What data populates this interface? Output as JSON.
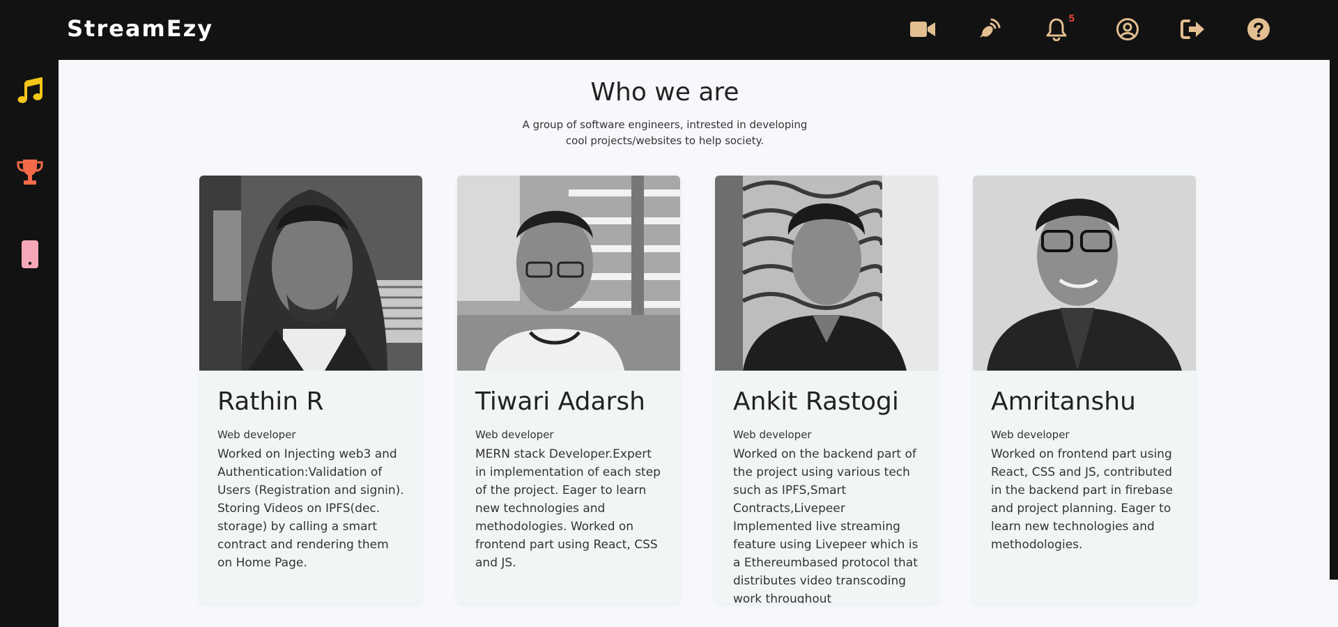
{
  "app": {
    "brand": "StreamEzy"
  },
  "topbar": {
    "icons": [
      {
        "name": "video-camera-icon"
      },
      {
        "name": "broadcast-icon"
      },
      {
        "name": "bell-icon",
        "badge": "5"
      },
      {
        "name": "user-circle-icon"
      },
      {
        "name": "logout-icon"
      },
      {
        "name": "help-icon"
      }
    ],
    "icon_color": "#e3be90",
    "badge_color": "#f0473c"
  },
  "sidebar": {
    "icons": [
      {
        "name": "music-note-icon",
        "color": "#f5c518"
      },
      {
        "name": "trophy-icon",
        "color": "#f36a4a"
      },
      {
        "name": "mobile-phone-icon",
        "color": "#f7a8b8"
      }
    ]
  },
  "main": {
    "title": "Who we are",
    "subtitle": "A group of software engineers, intrested in developing cool projects/websites to help society.",
    "team": [
      {
        "name": "Rathin R",
        "role": "Web developer",
        "description": "Worked on Injecting web3 and Authentication:Validation of Users (Registration and signin). Storing Videos on IPFS(dec. storage) by calling a smart contract and rendering them on Home Page."
      },
      {
        "name": "Tiwari Adarsh",
        "role": "Web developer",
        "description": "MERN stack Developer.Expert in implementation of each step of the project. Eager to learn new technologies and methodologies. Worked on frontend part using React, CSS and JS."
      },
      {
        "name": "Ankit Rastogi",
        "role": "Web developer",
        "description": "Worked on the backend part of the project using various tech such as IPFS,Smart Contracts,Livepeer Implemented live streaming feature using Livepeer which is a Ethereumbased protocol that distributes video transcoding work throughout"
      },
      {
        "name": "Amritanshu",
        "role": "Web developer",
        "description": "Worked on frontend part using React, CSS and JS, contributed in the backend part in firebase and project planning. Eager to learn new technologies and methodologies."
      }
    ]
  }
}
